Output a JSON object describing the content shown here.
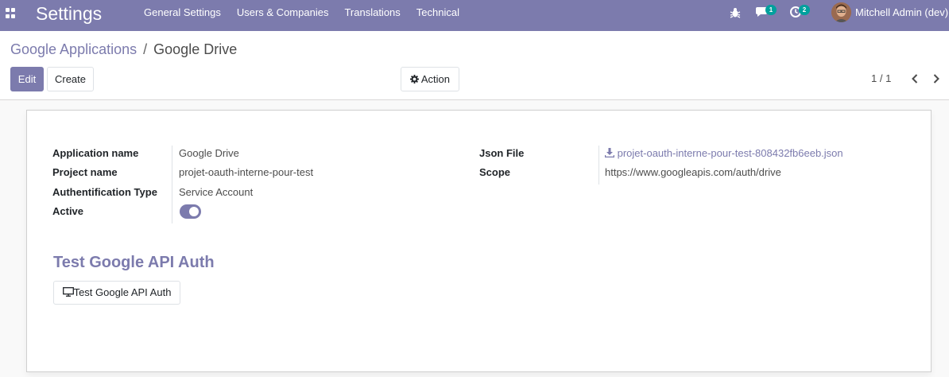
{
  "navbar": {
    "app_title": "Settings",
    "menu": [
      {
        "label": "General Settings"
      },
      {
        "label": "Users & Companies"
      },
      {
        "label": "Translations"
      },
      {
        "label": "Technical"
      }
    ],
    "messages_count": "1",
    "activities_count": "2",
    "user_name": "Mitchell Admin (dev)"
  },
  "breadcrumb": {
    "parent": "Google Applications",
    "separator": "/",
    "current": "Google Drive"
  },
  "toolbar": {
    "edit_label": "Edit",
    "create_label": "Create",
    "action_label": "Action"
  },
  "pager": {
    "value": "1 / 1"
  },
  "form": {
    "left_fields": [
      {
        "label": "Application name",
        "value": "Google Drive"
      },
      {
        "label": "Project name",
        "value": "projet-oauth-interne-pour-test"
      },
      {
        "label": "Authentification Type",
        "value": "Service Account"
      },
      {
        "label": "Active",
        "value": true
      }
    ],
    "right_fields": [
      {
        "label": "Json File",
        "value": "projet-oauth-interne-pour-test-808432fb6eeb.json"
      },
      {
        "label": "Scope",
        "value": "https://www.googleapis.com/auth/drive"
      }
    ],
    "section_title": "Test Google API Auth",
    "test_button_label": "Test Google API Auth"
  },
  "colors": {
    "brand": "#7c7bad",
    "badge": "#00a09d"
  }
}
